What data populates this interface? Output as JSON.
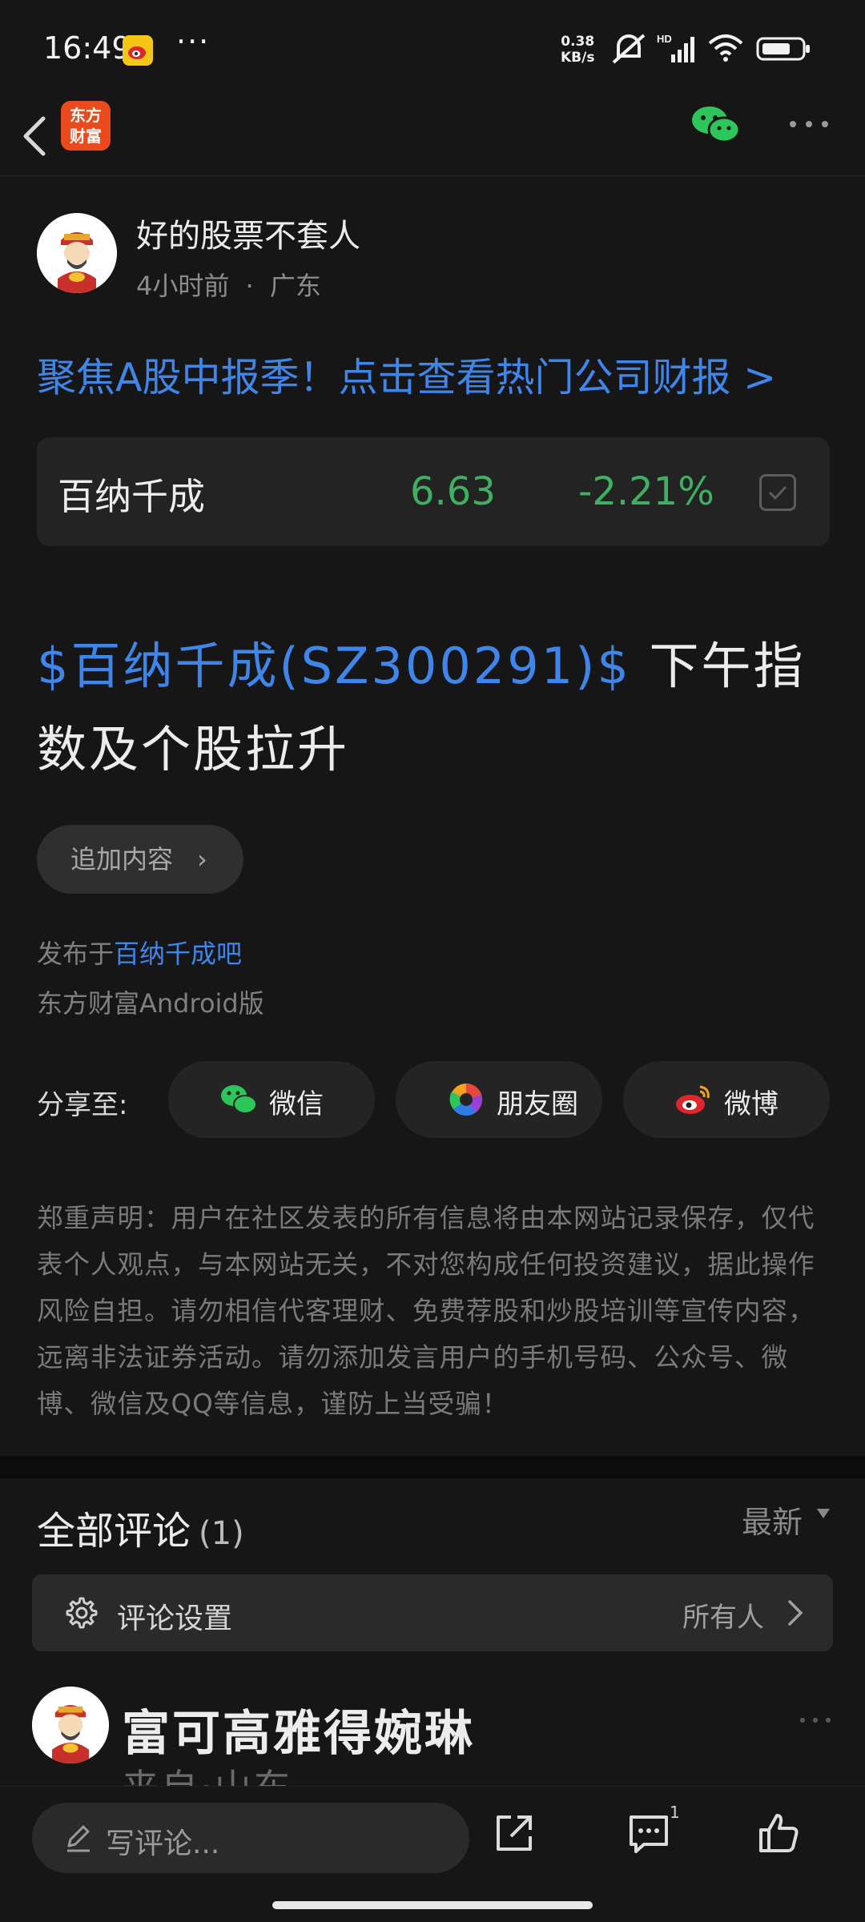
{
  "status_bar": {
    "time": "16:49",
    "overflow": "···",
    "net_speed_value": "0.38",
    "net_speed_unit": "KB/s",
    "hd_label": "HD",
    "icons": [
      "weibo-icon",
      "mute-icon",
      "signal-icon",
      "wifi-icon",
      "battery-icon"
    ]
  },
  "nav": {
    "logo_line1": "东方",
    "logo_line2": "财富",
    "icons": [
      "back-icon",
      "wechat-icon",
      "more-icon"
    ]
  },
  "author": {
    "name": "好的股票不套人",
    "time": "4小时前",
    "separator": "·",
    "location": "广东"
  },
  "promo": {
    "text": "聚焦A股中报季！点击查看热门公司财报 >"
  },
  "stock": {
    "name": "百纳千成",
    "price": "6.63",
    "change": "-2.21%",
    "change_color": "#3fb062"
  },
  "post": {
    "stock_tag": "$百纳千成(SZ300291)$",
    "text": " 下午指数及个股拉升"
  },
  "actions": {
    "append_label": "追加内容",
    "append_chevron": "›"
  },
  "meta": {
    "published_prefix": "发布于",
    "forum": "百纳千成吧",
    "source_app": "东方财富Android版"
  },
  "share": {
    "label": "分享至:",
    "buttons": [
      {
        "label": "微信",
        "icon": "wechat-icon"
      },
      {
        "label": "朋友圈",
        "icon": "moments-icon"
      },
      {
        "label": "微博",
        "icon": "weibo-icon"
      }
    ]
  },
  "disclaimer": "郑重声明：用户在社区发表的所有信息将由本网站记录保存，仅代表个人观点，与本网站无关，不对您构成任何投资建议，据此操作风险自担。请勿相信代客理财、免费荐股和炒股培训等宣传内容，远离非法证券活动。请勿添加发言用户的手机号码、公众号、微博、微信及QQ等信息，谨防上当受骗！",
  "comments": {
    "title": "全部评论",
    "count": "(1)",
    "sort_label": "最新",
    "settings_label": "评论设置",
    "settings_value": "所有人",
    "first": {
      "name": "富可高雅得婉琳",
      "location": "来自·山东"
    }
  },
  "bottom_bar": {
    "compose_placeholder": "写评论...",
    "comment_badge": "1",
    "icons": [
      "edit-icon",
      "share-icon",
      "comment-icon",
      "like-icon"
    ]
  },
  "colors": {
    "accent_blue": "#3f86ec",
    "stock_green": "#3fb062",
    "background": "#161616"
  }
}
